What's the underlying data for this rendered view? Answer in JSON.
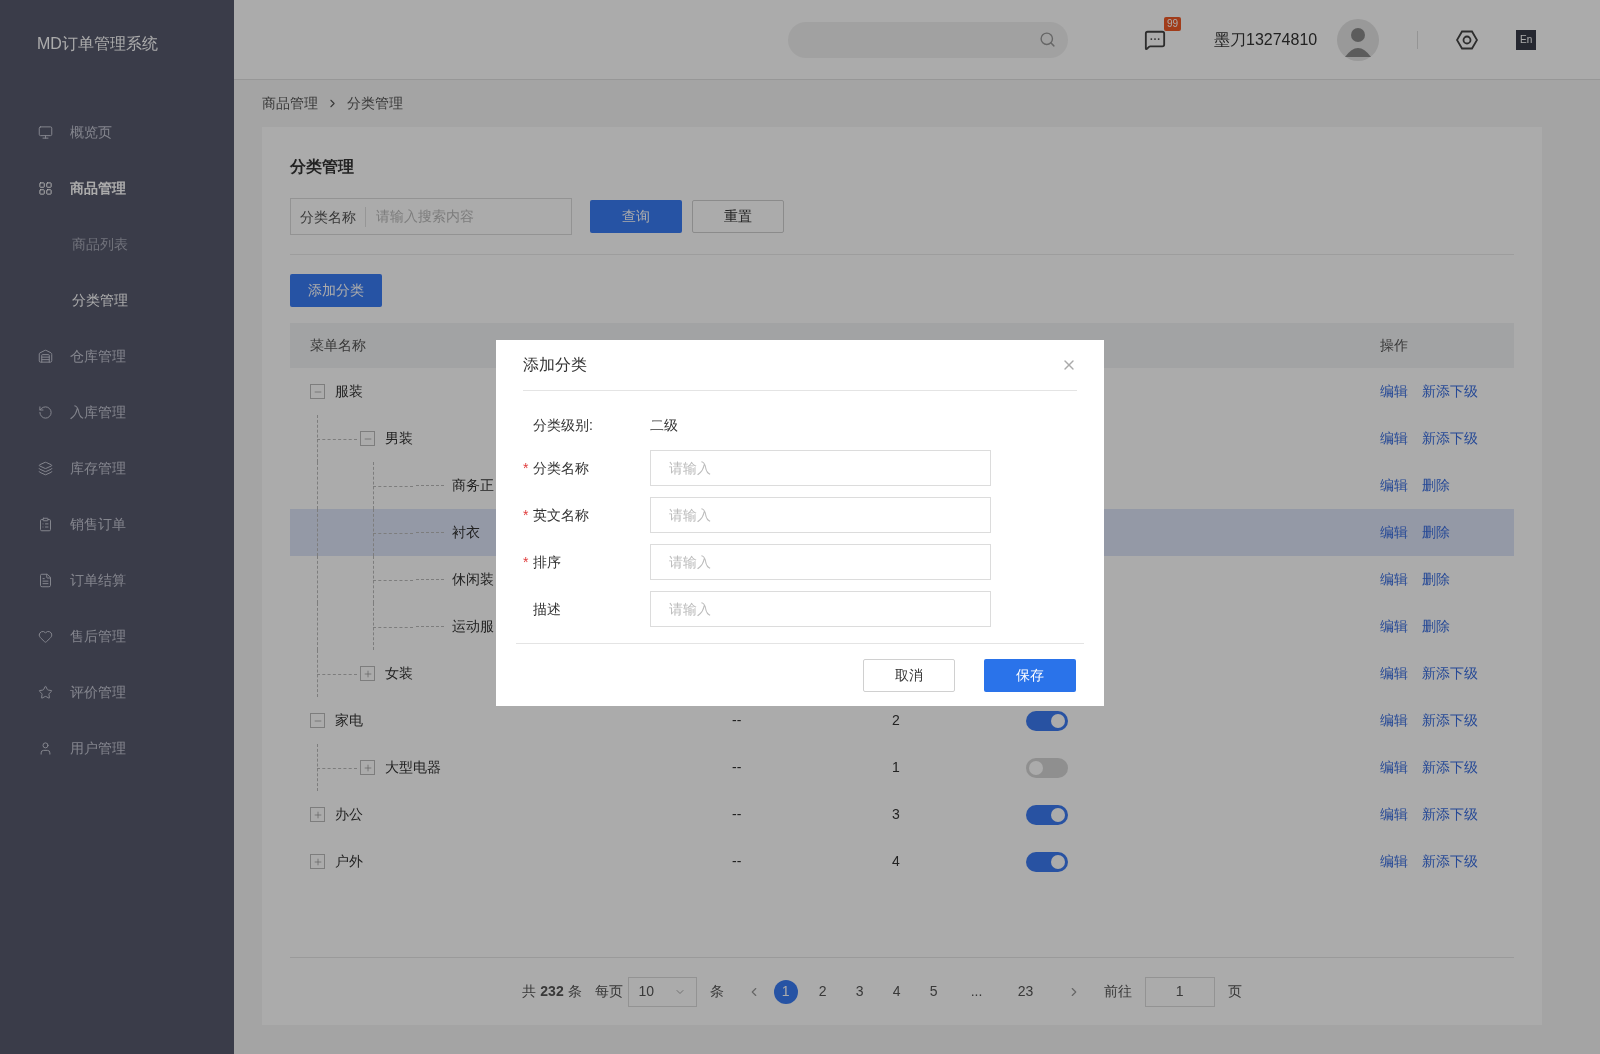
{
  "app": {
    "title": "MD订单管理系统"
  },
  "sidebar": {
    "items": [
      {
        "label": "概览页",
        "selected": false
      },
      {
        "label": "商品管理",
        "selected": false,
        "expanded": true,
        "children": [
          {
            "label": "商品列表",
            "selected": false
          },
          {
            "label": "分类管理",
            "selected": true
          }
        ]
      },
      {
        "label": "仓库管理",
        "selected": false
      },
      {
        "label": "入库管理",
        "selected": false
      },
      {
        "label": "库存管理",
        "selected": false
      },
      {
        "label": "销售订单",
        "selected": false
      },
      {
        "label": "订单结算",
        "selected": false
      },
      {
        "label": "售后管理",
        "selected": false
      },
      {
        "label": "评价管理",
        "selected": false
      },
      {
        "label": "用户管理",
        "selected": false
      }
    ]
  },
  "header": {
    "message_badge": "99",
    "username": "墨刀13274810",
    "language": "En"
  },
  "breadcrumb": [
    "商品管理",
    "分类管理"
  ],
  "page": {
    "title": "分类管理",
    "search_label": "分类名称",
    "search_placeholder": "请输入搜索内容",
    "query_button": "查询",
    "reset_button": "重置",
    "add_button": "添加分类"
  },
  "table": {
    "columns": [
      "菜单名称",
      "操作"
    ],
    "rows": [
      {
        "name": "服装",
        "expanded": true,
        "selected": false,
        "actions": [
          "编辑",
          "新添下级"
        ],
        "children": [
          {
            "name": "男装",
            "expanded": true,
            "selected": false,
            "actions": [
              "编辑",
              "新添下级"
            ],
            "children": [
              {
                "name": "商务正",
                "selected": false,
                "actions": [
                  "编辑",
                  "删除"
                ]
              },
              {
                "name": "衬衣",
                "selected": true,
                "actions": [
                  "编辑",
                  "删除"
                ]
              },
              {
                "name": "休闲装",
                "selected": false,
                "actions": [
                  "编辑",
                  "删除"
                ]
              },
              {
                "name": "运动服",
                "selected": false,
                "actions": [
                  "编辑",
                  "删除"
                ]
              }
            ]
          },
          {
            "name": "女装",
            "expanded": false,
            "selected": false,
            "actions": [
              "编辑",
              "新添下级"
            ]
          }
        ]
      },
      {
        "name": "家电",
        "expanded": true,
        "selected": false,
        "description": "--",
        "sort": "2",
        "enabled": true,
        "actions": [
          "编辑",
          "新添下级"
        ],
        "children": [
          {
            "name": "大型电器",
            "expanded": false,
            "selected": false,
            "description": "--",
            "sort": "1",
            "enabled": false,
            "actions": [
              "编辑",
              "新添下级"
            ]
          }
        ]
      },
      {
        "name": "办公",
        "expanded": false,
        "selected": false,
        "description": "--",
        "sort": "3",
        "enabled": true,
        "actions": [
          "编辑",
          "新添下级"
        ]
      },
      {
        "name": "户外",
        "expanded": false,
        "selected": false,
        "description": "--",
        "sort": "4",
        "enabled": true,
        "actions": [
          "编辑",
          "新添下级"
        ]
      }
    ]
  },
  "pagination": {
    "total": "共 **232** 条",
    "per_page_label": "每页",
    "per_page": "10",
    "per_page_unit": "条",
    "pages": [
      {
        "label": "1",
        "selected": true
      },
      {
        "label": "2",
        "selected": false
      },
      {
        "label": "3",
        "selected": false
      },
      {
        "label": "4",
        "selected": false
      },
      {
        "label": "5",
        "selected": false
      },
      {
        "label": "...",
        "selected": false
      },
      {
        "label": "23",
        "selected": false
      }
    ],
    "goto_label": "前往",
    "goto_value": "1",
    "goto_unit": "页"
  },
  "dialog": {
    "title": "添加分类",
    "required_mark": "*",
    "fields": [
      {
        "kind": "static",
        "label": "分类级别:",
        "value": "二级"
      },
      {
        "kind": "input",
        "label": "分类名称",
        "required": true,
        "placeholder": "请输入"
      },
      {
        "kind": "input",
        "label": "英文名称",
        "required": true,
        "placeholder": "请输入"
      },
      {
        "kind": "input",
        "label": "排序",
        "required": true,
        "placeholder": "请输入"
      },
      {
        "kind": "input",
        "label": "描述",
        "required": false,
        "placeholder": "请输入"
      }
    ],
    "buttons": [
      {
        "kind": "secondary",
        "label": "取消"
      },
      {
        "kind": "primary",
        "label": "保存"
      }
    ]
  }
}
